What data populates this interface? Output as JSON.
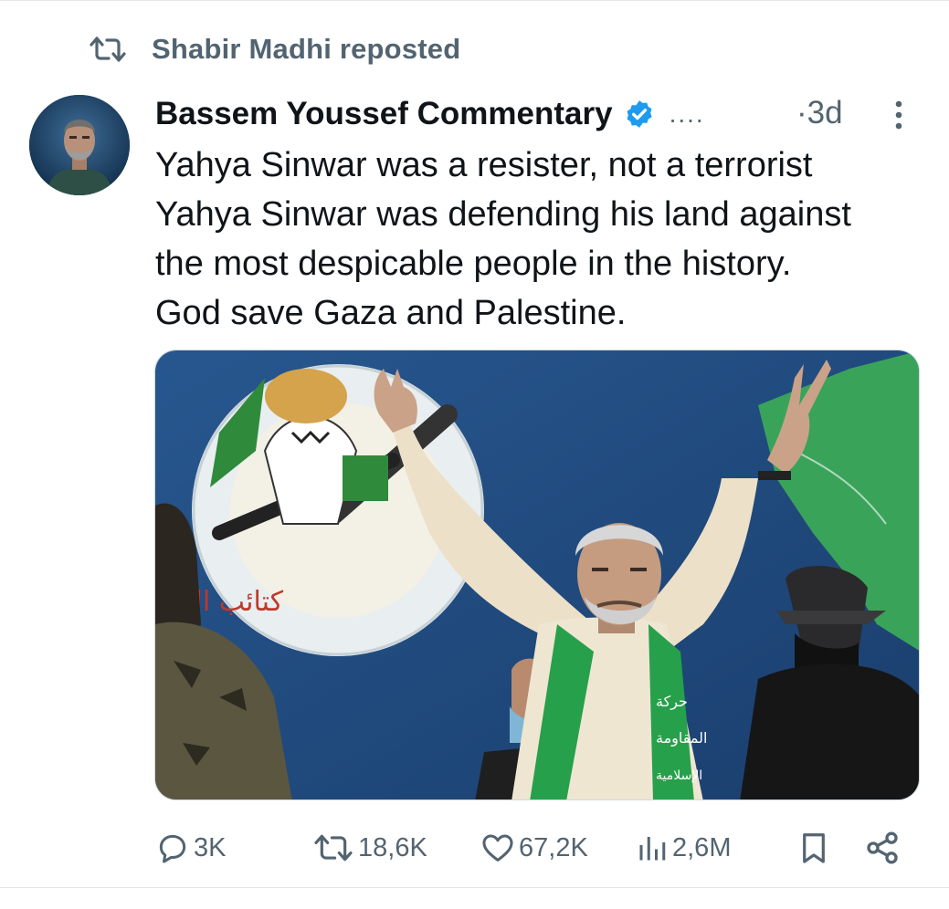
{
  "repost": {
    "text": "Shabir Madhi reposted",
    "icon": "repost-icon"
  },
  "tweet": {
    "author": "Bassem Youssef Commentary",
    "verified": true,
    "handle_truncated": "....",
    "timestamp": "·3d",
    "text_lines": [
      "Yahya Sinwar was a resister, not a terrorist",
      "Yahya Sinwar was defending his land against",
      "the most despicable people in the history.",
      "God save Gaza and Palestine."
    ],
    "media": {
      "type": "photo",
      "overlay_text": [
        "كتائب الشهيد عز الدين القسام",
        "حركة المقاومة الإسلامية"
      ]
    }
  },
  "actions": {
    "replies": "3K",
    "reposts": "18,6K",
    "likes": "67,2K",
    "views": "2,6M"
  },
  "colors": {
    "text": "#0f1419",
    "secondary": "#536471",
    "verified": "#1d9bf0",
    "divider": "#e6e6e6"
  }
}
